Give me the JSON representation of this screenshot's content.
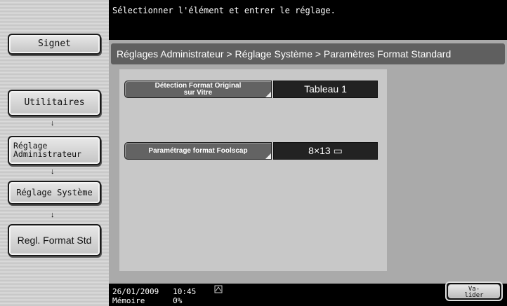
{
  "message": "Sélectionner l'élément et entrer le réglage.",
  "sidebar": {
    "signet": "Signet",
    "steps": [
      {
        "label": "Utilitaires"
      },
      {
        "label_line1": "Réglage",
        "label_line2": "Administrateur"
      },
      {
        "label": "Réglage Système"
      },
      {
        "label": "Regl. Format Std"
      }
    ],
    "arrow": "↓"
  },
  "breadcrumb": "Réglages Administrateur > Réglage Système > Paramètres Format Standard",
  "settings": [
    {
      "label_line1": "Détection Format Original",
      "label_line2": "sur Vitre",
      "value": "Tableau 1"
    },
    {
      "label": "Paramétrage format Foolscap",
      "value": "8×13 ▭"
    }
  ],
  "footer": {
    "date": "26/01/2009",
    "time": "10:45",
    "memory_label": "Mémoire",
    "memory_value": "0%",
    "validate_line1": "Va-",
    "validate_line2": "lider"
  }
}
